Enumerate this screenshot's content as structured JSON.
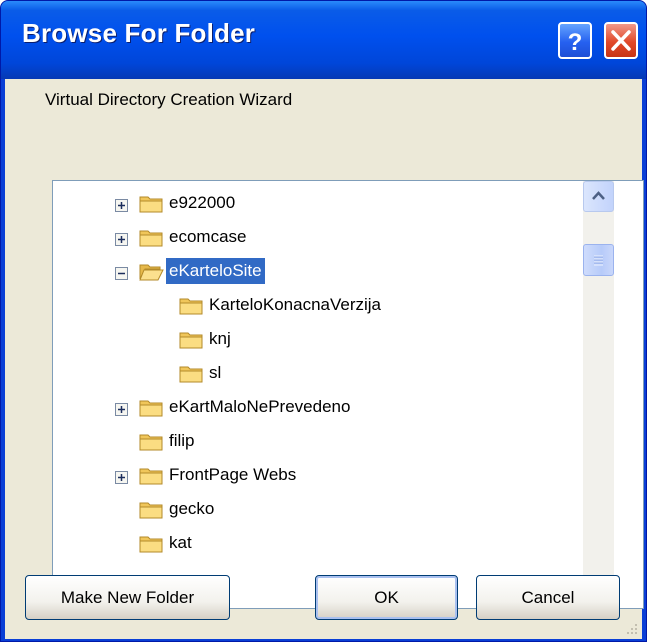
{
  "window": {
    "title": "Browse For Folder",
    "controls": {
      "help_icon": "question-mark-icon",
      "close_icon": "x-close-icon"
    }
  },
  "description": "Virtual Directory Creation Wizard",
  "tree": {
    "items": [
      {
        "label": "e922000",
        "expander": "plus",
        "level": 1,
        "selected": false
      },
      {
        "label": "ecomcase",
        "expander": "plus",
        "level": 1,
        "selected": false
      },
      {
        "label": "eKarteloSite",
        "expander": "minus",
        "level": 1,
        "selected": true,
        "open": true
      },
      {
        "label": "KarteloKonacnaVerzija",
        "expander": "none",
        "level": 2,
        "selected": false
      },
      {
        "label": "knj",
        "expander": "none",
        "level": 2,
        "selected": false
      },
      {
        "label": "sl",
        "expander": "none",
        "level": 2,
        "selected": false
      },
      {
        "label": "eKartMaloNePrevedeno",
        "expander": "plus",
        "level": 1,
        "selected": false
      },
      {
        "label": "filip",
        "expander": "none",
        "level": 1,
        "selected": false
      },
      {
        "label": "FrontPage Webs",
        "expander": "plus",
        "level": 1,
        "selected": false
      },
      {
        "label": "gecko",
        "expander": "none",
        "level": 1,
        "selected": false
      },
      {
        "label": "kat",
        "expander": "none",
        "level": 1,
        "selected": false
      }
    ]
  },
  "buttons": {
    "make_new_folder": "Make New Folder",
    "ok": "OK",
    "cancel": "Cancel"
  },
  "colors": {
    "titlebar": "#0050ee",
    "selection": "#316ac5",
    "dialog_bg": "#ece9d8"
  }
}
